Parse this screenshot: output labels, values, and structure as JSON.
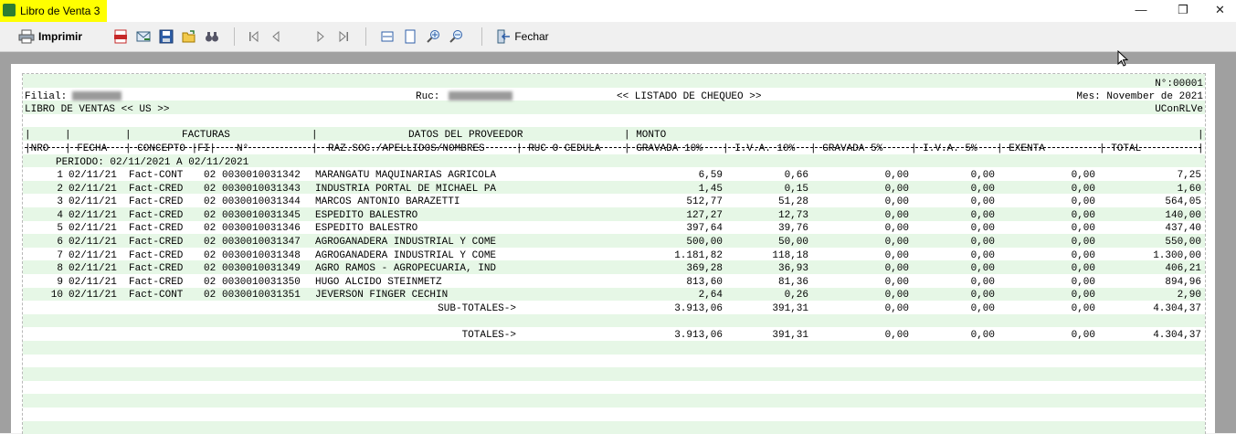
{
  "window": {
    "title": "Libro de Venta 3",
    "minimize": "—",
    "maximize": "❐",
    "close": "✕"
  },
  "toolbar": {
    "print_label": "Imprimir",
    "close_label": "Fechar"
  },
  "report": {
    "page_number": "N°:00001",
    "filial_label": "Filial:",
    "ruc_label": "Ruc:",
    "title": "<< LISTADO DE CHEQUEO >>",
    "month": "Mes: November de 2021",
    "subtitle": "LIBRO DE VENTAS << US >>",
    "report_code": "UConRLVe",
    "header_row1": "|       |          |                      |                                            | MONTO                                                                                           ",
    "header_row1b": "|       |          FACTURAS          |              DATOS DEL PROVEEDOR              |",
    "header_row1_full": "|      |         |          FACTURAS         |               DATOS DEL PROVEEDOR               | MONTO                                                                                            |",
    "header_row2": "|NRO  | FECHA  | CONCEPTO |FI|  N°           |  RAZ.SOC./APELLIDOS/NOMBRES  | RUC O CEDULA  | GRAVADA 10%  | I.V.A. 10% | GRAVADA 5%   | I.V.A. 5%  | EXENTA        | TOTAL          |",
    "divider": "----------------------------------------------------------------------------------------------------------------------------------------------------------------------------------------------------------",
    "period": "PERIODO: 02/11/2021 A 02/11/2021",
    "rows": [
      {
        "nro": "1",
        "fecha": "02/11/21",
        "concepto": "Fact-CONT",
        "fi": "02",
        "num": "0030010031342",
        "razon": "MARANGATU MAQUINARIAS AGRICOLA",
        "g10": "6,59",
        "iva10": "0,66",
        "g5": "0,00",
        "iva5": "0,00",
        "exenta": "0,00",
        "total": "7,25"
      },
      {
        "nro": "2",
        "fecha": "02/11/21",
        "concepto": "Fact-CRED",
        "fi": "02",
        "num": "0030010031343",
        "razon": "INDUSTRIA PORTAL DE MICHAEL PA",
        "g10": "1,45",
        "iva10": "0,15",
        "g5": "0,00",
        "iva5": "0,00",
        "exenta": "0,00",
        "total": "1,60"
      },
      {
        "nro": "3",
        "fecha": "02/11/21",
        "concepto": "Fact-CRED",
        "fi": "02",
        "num": "0030010031344",
        "razon": "MARCOS ANTONIO BARAZETTI",
        "g10": "512,77",
        "iva10": "51,28",
        "g5": "0,00",
        "iva5": "0,00",
        "exenta": "0,00",
        "total": "564,05"
      },
      {
        "nro": "4",
        "fecha": "02/11/21",
        "concepto": "Fact-CRED",
        "fi": "02",
        "num": "0030010031345",
        "razon": "ESPEDITO BALESTRO",
        "g10": "127,27",
        "iva10": "12,73",
        "g5": "0,00",
        "iva5": "0,00",
        "exenta": "0,00",
        "total": "140,00"
      },
      {
        "nro": "5",
        "fecha": "02/11/21",
        "concepto": "Fact-CRED",
        "fi": "02",
        "num": "0030010031346",
        "razon": "ESPEDITO BALESTRO",
        "g10": "397,64",
        "iva10": "39,76",
        "g5": "0,00",
        "iva5": "0,00",
        "exenta": "0,00",
        "total": "437,40"
      },
      {
        "nro": "6",
        "fecha": "02/11/21",
        "concepto": "Fact-CRED",
        "fi": "02",
        "num": "0030010031347",
        "razon": "AGROGANADERA INDUSTRIAL Y COME",
        "g10": "500,00",
        "iva10": "50,00",
        "g5": "0,00",
        "iva5": "0,00",
        "exenta": "0,00",
        "total": "550,00"
      },
      {
        "nro": "7",
        "fecha": "02/11/21",
        "concepto": "Fact-CRED",
        "fi": "02",
        "num": "0030010031348",
        "razon": "AGROGANADERA INDUSTRIAL Y COME",
        "g10": "1.181,82",
        "iva10": "118,18",
        "g5": "0,00",
        "iva5": "0,00",
        "exenta": "0,00",
        "total": "1.300,00"
      },
      {
        "nro": "8",
        "fecha": "02/11/21",
        "concepto": "Fact-CRED",
        "fi": "02",
        "num": "0030010031349",
        "razon": "AGRO RAMOS - AGROPECUARIA, IND",
        "g10": "369,28",
        "iva10": "36,93",
        "g5": "0,00",
        "iva5": "0,00",
        "exenta": "0,00",
        "total": "406,21"
      },
      {
        "nro": "9",
        "fecha": "02/11/21",
        "concepto": "Fact-CRED",
        "fi": "02",
        "num": "0030010031350",
        "razon": "HUGO ALCIDO STEINMETZ",
        "g10": "813,60",
        "iva10": "81,36",
        "g5": "0,00",
        "iva5": "0,00",
        "exenta": "0,00",
        "total": "894,96"
      },
      {
        "nro": "10",
        "fecha": "02/11/21",
        "concepto": "Fact-CONT",
        "fi": "02",
        "num": "0030010031351",
        "razon": "JEVERSON FINGER CECHIN",
        "g10": "2,64",
        "iva10": "0,26",
        "g5": "0,00",
        "iva5": "0,00",
        "exenta": "0,00",
        "total": "2,90"
      }
    ],
    "subtotal": {
      "label": "SUB-TOTALES->",
      "g10": "3.913,06",
      "iva10": "391,31",
      "g5": "0,00",
      "iva5": "0,00",
      "exenta": "0,00",
      "total": "4.304,37"
    },
    "total": {
      "label": "TOTALES->",
      "g10": "3.913,06",
      "iva10": "391,31",
      "g5": "0,00",
      "iva5": "0,00",
      "exenta": "0,00",
      "total": "4.304,37"
    }
  }
}
